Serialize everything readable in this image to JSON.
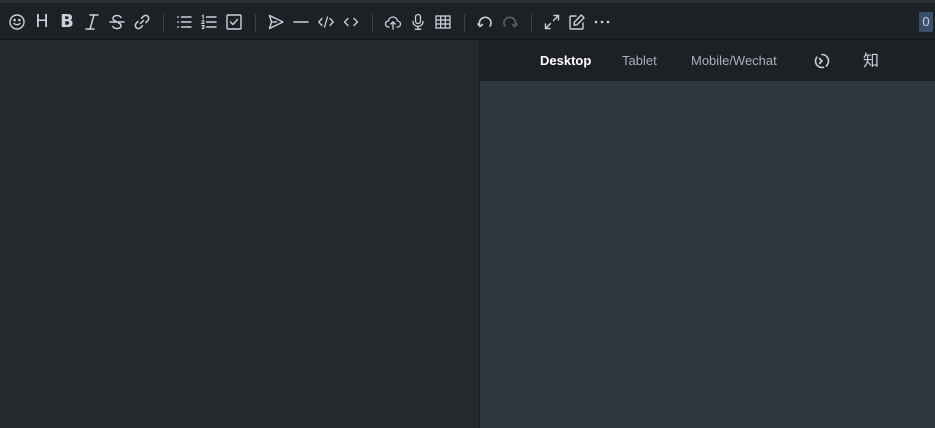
{
  "toolbar": {
    "heading_glyph": "H",
    "bold_glyph": "B",
    "italic_glyph": "I",
    "counter": "0"
  },
  "preview": {
    "tabs": [
      "Desktop",
      "Tablet",
      "Mobile/Wechat"
    ],
    "active_tab": "Desktop",
    "zhihu_label": "知"
  },
  "icons": [
    "emoji-icon",
    "heading-icon",
    "bold-icon",
    "italic-icon",
    "strikethrough-icon",
    "link-icon",
    "unordered-list-icon",
    "ordered-list-icon",
    "checklist-icon",
    "quote-icon",
    "horizontal-rule-icon",
    "inline-code-icon",
    "code-block-icon",
    "upload-icon",
    "record-icon",
    "table-icon",
    "undo-icon",
    "redo-icon",
    "fullscreen-icon",
    "edit-mode-icon",
    "more-icon",
    "theme-icon"
  ],
  "colors": {
    "toolbar_bg": "#1d2125",
    "editor_bg": "#24292e",
    "preview_bg": "#2f363e",
    "icon": "#c9d1d9",
    "counter_bg": "#3a4d6a"
  }
}
